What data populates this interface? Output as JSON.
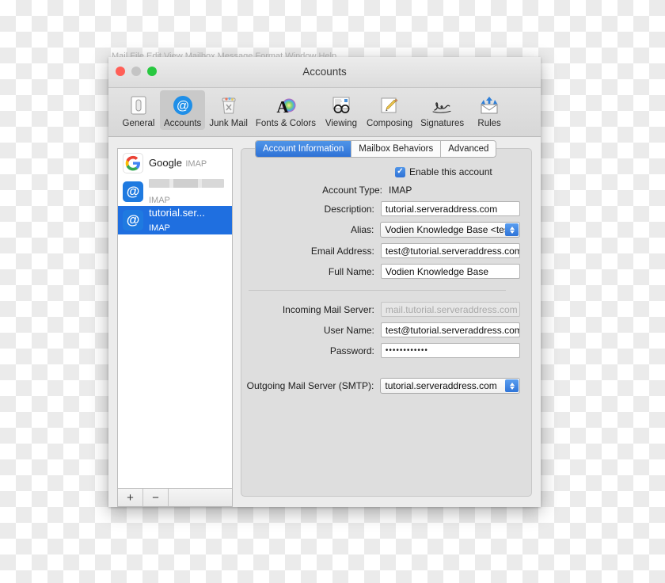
{
  "window": {
    "title": "Accounts",
    "ghost_strip": "Mail  File  Edit  View  Mailbox  Message  Format  Window  Help",
    "traffic_lights": {
      "close": "close-button",
      "minimize": "minimize-button",
      "zoom": "zoom-button"
    }
  },
  "toolbar": {
    "items": [
      {
        "label": "General",
        "icon": "general-icon",
        "selected": false
      },
      {
        "label": "Accounts",
        "icon": "accounts-at-icon",
        "selected": true
      },
      {
        "label": "Junk Mail",
        "icon": "junk-mail-icon",
        "selected": false
      },
      {
        "label": "Fonts & Colors",
        "icon": "fonts-colors-icon",
        "selected": false
      },
      {
        "label": "Viewing",
        "icon": "viewing-icon",
        "selected": false
      },
      {
        "label": "Composing",
        "icon": "composing-icon",
        "selected": false
      },
      {
        "label": "Signatures",
        "icon": "signatures-icon",
        "selected": false
      },
      {
        "label": "Rules",
        "icon": "rules-icon",
        "selected": false
      }
    ]
  },
  "sidebar": {
    "accounts": [
      {
        "name": "Google",
        "type": "IMAP",
        "icon": "google-logo-icon",
        "selected": false,
        "redacted": false
      },
      {
        "name": "",
        "type": "IMAP",
        "icon": "at-icon",
        "selected": false,
        "redacted": true
      },
      {
        "name": "tutorial.ser...",
        "type": "IMAP",
        "icon": "at-icon",
        "selected": true,
        "redacted": false
      }
    ],
    "add_label": "+",
    "remove_label": "−"
  },
  "tabs": [
    {
      "label": "Account Information",
      "active": true
    },
    {
      "label": "Mailbox Behaviors",
      "active": false
    },
    {
      "label": "Advanced",
      "active": false
    }
  ],
  "form": {
    "enable_account": {
      "label": "Enable this account",
      "checked": true
    },
    "account_type": {
      "label": "Account Type:",
      "value": "IMAP"
    },
    "description": {
      "label": "Description:",
      "value": "tutorial.serveraddress.com"
    },
    "alias": {
      "label": "Alias:",
      "value": "Vodien Knowledge Base <test"
    },
    "email_address": {
      "label": "Email Address:",
      "value": "test@tutorial.serveraddress.com"
    },
    "full_name": {
      "label": "Full Name:",
      "value": "Vodien Knowledge Base"
    },
    "incoming_mail_server": {
      "label": "Incoming Mail Server:",
      "value": "mail.tutorial.serveraddress.com"
    },
    "user_name": {
      "label": "User Name:",
      "value": "test@tutorial.serveraddress.com"
    },
    "password": {
      "label": "Password:",
      "value": "••••••••••••"
    },
    "outgoing_mail_server": {
      "label": "Outgoing Mail Server (SMTP):",
      "value": "tutorial.serveraddress.com"
    }
  },
  "footer": {
    "help_label": "?"
  },
  "colors": {
    "accent_blue": "#2f72d6",
    "selection_blue": "#1f6fe0",
    "window_chrome": "#ececec",
    "panel_bg": "#dedede"
  }
}
